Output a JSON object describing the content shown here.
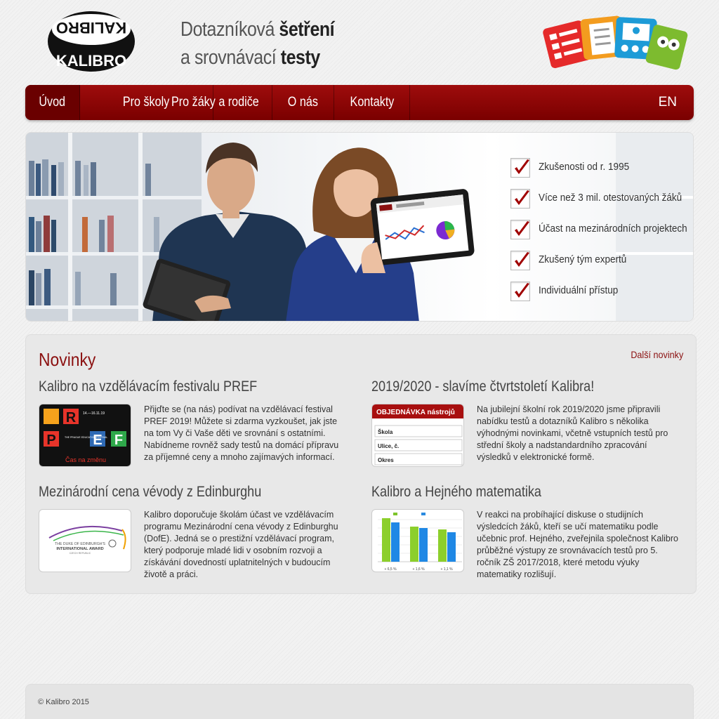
{
  "brand": {
    "logo_text_top": "KALIBRO",
    "logo_text_bottom": "KALIBRO",
    "tagline_line1_normal": "Dotazníková ",
    "tagline_line1_bold": "šetření",
    "tagline_line2_normal": "a srovnávací ",
    "tagline_line2_bold": "testy"
  },
  "nav": {
    "items": [
      {
        "label": "Úvod",
        "active": true
      },
      {
        "label": "Pro školy"
      },
      {
        "label": "Pro žáky a rodiče"
      },
      {
        "label": "O nás"
      },
      {
        "label": "Kontakty"
      }
    ],
    "lang": "EN"
  },
  "hero": {
    "features": [
      "Zkušenosti od r. 1995",
      "Více než 3 mil. otestovaných žáků",
      "Účast na mezinárodních projektech",
      "Zkušený tým expertů",
      "Individuální přístup"
    ]
  },
  "news": {
    "title": "Novinky",
    "more": "Další novinky",
    "articles": [
      {
        "title": "Kalibro na vzdělávacím festivalu PREF",
        "text": "Přijďte se (na nás) podívat na vzdělávací festival PREF 2019! Můžete si zdarma vyzkoušet, jak jste na tom Vy či Vaše děti ve srovnání s ostatními. Nabídneme rovněž sady testů na domácí přípravu za příjemné ceny a mnoho zajímavých informací.",
        "thumb": {
          "letters": [
            "P",
            "R",
            "E",
            "F"
          ],
          "dates": "14.—16.11.19",
          "caption": "Čas na změnu",
          "sub": "THE PRAGUE EDUCATION FESTIVAL"
        }
      },
      {
        "title": "2019/2020 - slavíme čtvrtstoletí Kalibra!",
        "text": "Na jubilejní školní rok 2019/2020 jsme připravili nabídku testů a dotazníků Kalibro s několika výhodnými novinkami, včetně vstupních testů pro střední školy a nadstandardního zpracování výsledků v elektronické formě.",
        "thumb": {
          "header": "OBJEDNÁVKA nástrojů",
          "rows": [
            "Škola",
            "Ulice, č.",
            "Okres"
          ]
        }
      },
      {
        "title": "Mezinárodní cena vévody z Edinburghu",
        "text": "Kalibro doporučuje školám účast ve vzdělávacím programu Mezinárodní cena vévody z Edinburghu (DofE). Jedná se o prestižní vzdělávací program, který podporuje mladé lidi v osobním rozvoji a získávání dovedností uplatnitelných v budoucím životě a práci.",
        "thumb": {
          "line1": "THE DUKE OF EDINBURGH'S",
          "line2": "INTERNATIONAL AWARD",
          "line3": "CZECH REPUBLIC"
        }
      },
      {
        "title": "Kalibro a Hejného matematika",
        "text": "V reakci na probíhající diskuse o studijních výsledcích žáků, kteří se učí matematiku podle učebnic prof. Hejného, zveřejnila společnost Kalibro průběžné výstupy ze srovnávacích testů pro 5. ročník ZŠ 2017/2018, které metodu výuky matematiky rozlišují.",
        "thumb": {
          "labels": [
            "+ 6,5 %",
            "+ 1,6 %",
            "+ 1,1 %"
          ]
        }
      }
    ]
  },
  "footer": {
    "text": "© Kalibro 2015"
  },
  "colors": {
    "brand_red": "#8b0000",
    "check_red": "#a00000"
  }
}
